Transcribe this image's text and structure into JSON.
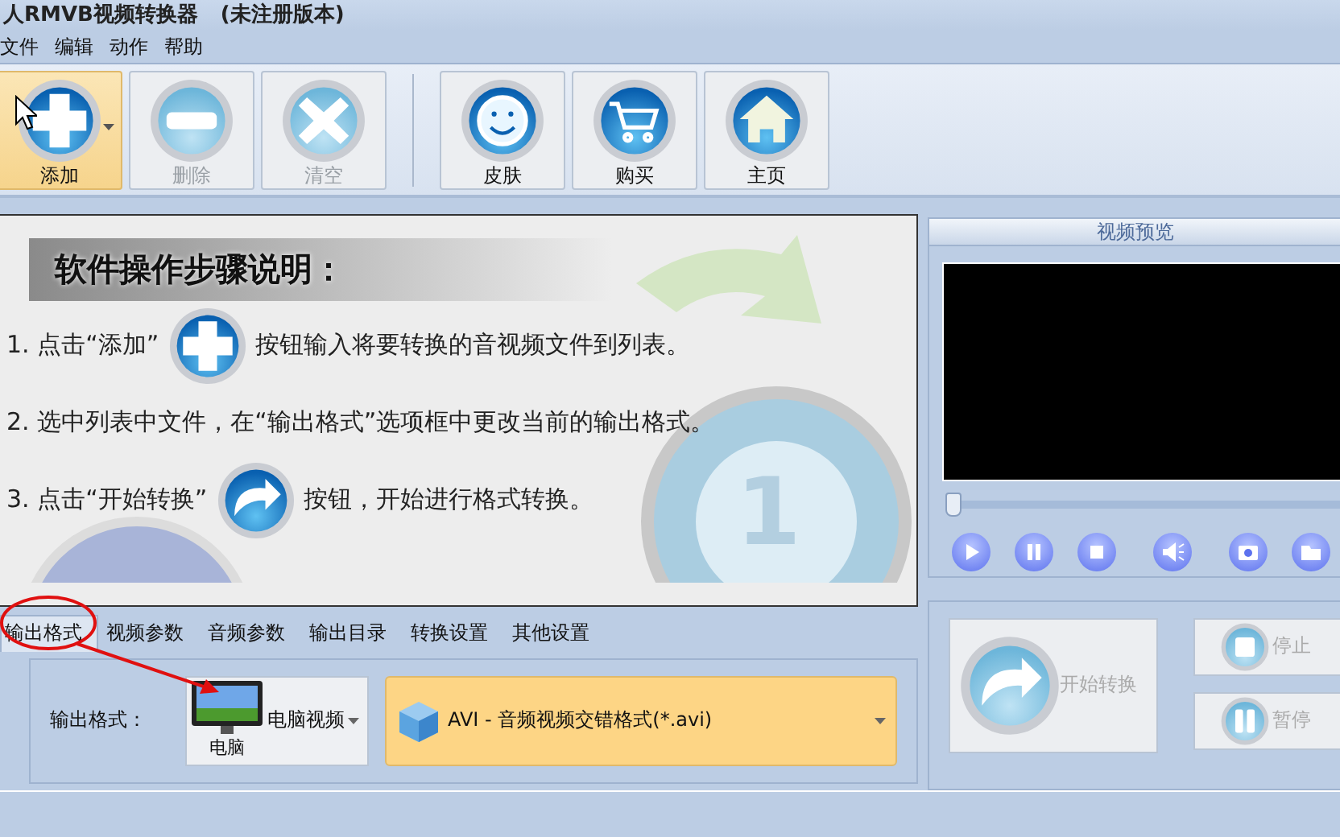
{
  "window": {
    "title": "人RMVB视频转换器",
    "subtitle": "(未注册版本)"
  },
  "menu": [
    "文件",
    "编辑",
    "动作",
    "帮助"
  ],
  "toolbar": {
    "groups": [
      [
        {
          "label": "添加",
          "kind": "add",
          "disabled": false,
          "highlighted": true,
          "dropdown": true
        },
        {
          "label": "删除",
          "kind": "remove",
          "disabled": true,
          "highlighted": false,
          "dropdown": false
        },
        {
          "label": "清空",
          "kind": "clear",
          "disabled": true,
          "highlighted": false,
          "dropdown": false
        }
      ],
      [
        {
          "label": "皮肤",
          "kind": "skin",
          "disabled": false,
          "highlighted": false,
          "dropdown": false
        },
        {
          "label": "购买",
          "kind": "cart",
          "disabled": false,
          "highlighted": false,
          "dropdown": false
        },
        {
          "label": "主页",
          "kind": "home",
          "disabled": false,
          "highlighted": false,
          "dropdown": false
        }
      ]
    ]
  },
  "guide": {
    "heading": "软件操作步骤说明：",
    "badge": "1",
    "steps": [
      {
        "kind": "add",
        "before": "1. 点击“添加”",
        "after": "按钮输入将要转换的音视频文件到列表。"
      },
      {
        "kind": "plain",
        "before": "2. 选中列表中文件，在“输出格式”选项框中更改当前的输出格式。"
      },
      {
        "kind": "convert",
        "before": "3. 点击“开始转换”",
        "after": "按钮，开始进行格式转换。"
      }
    ]
  },
  "preview": {
    "title": "视频预览",
    "seek": {
      "level": 0.0
    }
  },
  "tabs": [
    {
      "label": "输出格式",
      "selected": true
    },
    {
      "label": "视频参数",
      "selected": false
    },
    {
      "label": "音频参数",
      "selected": false
    },
    {
      "label": "输出目录",
      "selected": false
    },
    {
      "label": "转换设置",
      "selected": false
    },
    {
      "label": "其他设置",
      "selected": false
    }
  ],
  "output": {
    "label": "输出格式：",
    "device": {
      "name": "电脑视频",
      "caption": "电脑"
    },
    "format": "AVI - 音频视频交错格式(*.avi)"
  },
  "actions": {
    "start": {
      "label": "开始转换",
      "disabled": true
    },
    "stop": {
      "label": "停止",
      "disabled": true
    },
    "pause": {
      "label": "暂停",
      "disabled": true
    }
  }
}
